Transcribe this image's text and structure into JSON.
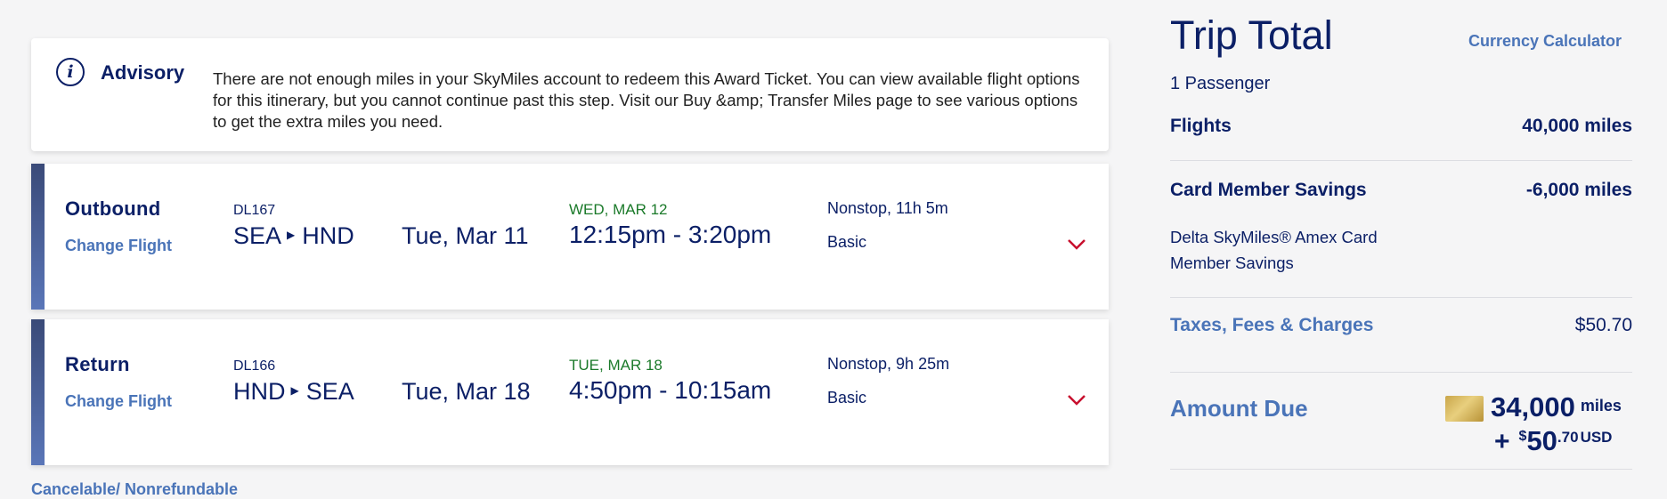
{
  "advisory": {
    "icon": "info-icon",
    "icon_glyph": "i",
    "title": "Advisory",
    "message": "There are not enough miles in your SkyMiles account to redeem this Award Ticket. You can view available flight options for this itinerary, but you cannot continue past this step. Visit our Buy &amp; Transfer Miles page to see various options to get the extra miles you need."
  },
  "flights": [
    {
      "direction": "Outbound",
      "change_label": "Change Flight",
      "flight_number": "DL167",
      "origin": "SEA",
      "destination": "HND",
      "departure_date": "Tue, Mar 11",
      "arrival_date": "WED, MAR 12",
      "times": "12:15pm - 3:20pm",
      "stops_duration": "Nonstop, 11h 5m",
      "fare_class": "Basic"
    },
    {
      "direction": "Return",
      "change_label": "Change Flight",
      "flight_number": "DL166",
      "origin": "HND",
      "destination": "SEA",
      "departure_date": "Tue, Mar 18",
      "arrival_date": "TUE, MAR 18",
      "times": "4:50pm - 10:15am",
      "stops_duration": "Nonstop, 9h 25m",
      "fare_class": "Basic"
    }
  ],
  "cancel_policy": "Cancelable/ Nonrefundable",
  "summary": {
    "title": "Trip Total",
    "currency_link": "Currency Calculator",
    "passengers": "1 Passenger",
    "flights_label": "Flights",
    "flights_value": "40,000 miles",
    "savings_label": "Card Member Savings",
    "savings_value": "-6,000 miles",
    "savings_desc": "Delta SkyMiles® Amex Card Member Savings",
    "taxes_label": "Taxes, Fees & Charges",
    "taxes_value": "$50.70",
    "amount_label": "Amount Due",
    "amount_miles": "34,000",
    "amount_miles_unit": "miles",
    "amount_plus": "+",
    "amount_currency_symbol": "$",
    "amount_usd_whole": "50",
    "amount_usd_cents": ".70",
    "amount_usd_code": "USD"
  },
  "colors": {
    "navy": "#0b1f66",
    "link_blue": "#4a74b8",
    "arrival_green": "#1b7a2a",
    "chevron_red": "#c8102e"
  }
}
